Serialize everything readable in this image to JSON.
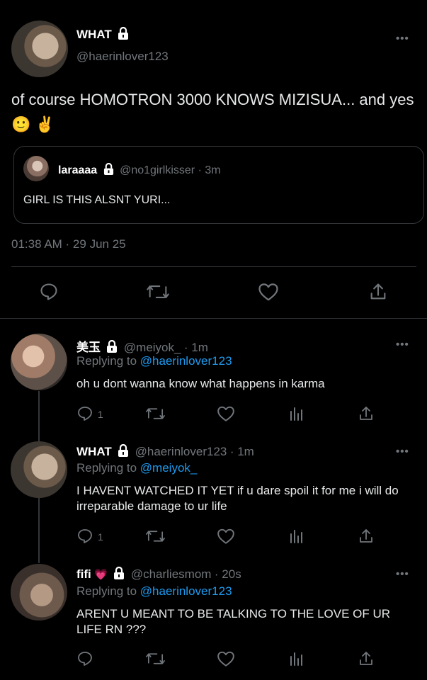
{
  "main_tweet": {
    "display_name": "WHAT",
    "handle": "@haerinlover123",
    "text": "of course HOMOTRON 3000 KNOWS MIZISUA... and yes",
    "emojis": "🙂 ✌️",
    "timestamp": "01:38 AM · 29 Jun 25",
    "more": "•••"
  },
  "quoted_tweet": {
    "display_name": "laraaaa",
    "handle": "@no1girlkisser",
    "time": "· 3m",
    "text": "GIRL IS THIS ALSNT YURI..."
  },
  "replies": [
    {
      "display_name": "美玉",
      "handle": "@meiyok_",
      "time": "· 1m",
      "replying_label": "Replying to",
      "replying_to": "@haerinlover123",
      "text": "oh u dont wanna know what happens in karma",
      "reply_count": "1",
      "more": "•••"
    },
    {
      "display_name": "WHAT",
      "handle": "@haerinlover123",
      "time": "· 1m",
      "replying_label": "Replying to",
      "replying_to": "@meiyok_",
      "text": "I HAVENT WATCHED IT YET if u dare spoil it for me i will do irreparable damage to ur life",
      "reply_count": "1",
      "more": "•••"
    },
    {
      "display_name": "fifi",
      "name_emoji": "💗",
      "handle": "@charliesmom",
      "time": "· 20s",
      "replying_label": "Replying to",
      "replying_to": "@haerinlover123",
      "text": "ARENT U MEANT TO BE TALKING TO THE LOVE OF UR LIFE RN ???",
      "reply_count": "",
      "more": "•••"
    }
  ],
  "colors": {
    "background": "#000000",
    "text": "#e7e9ea",
    "muted": "#71767b",
    "link": "#1d9bf0",
    "divider": "#2f3336"
  },
  "icons": [
    "lock-icon",
    "reply-icon",
    "retweet-icon",
    "like-icon",
    "share-icon",
    "analytics-icon",
    "more-icon"
  ]
}
